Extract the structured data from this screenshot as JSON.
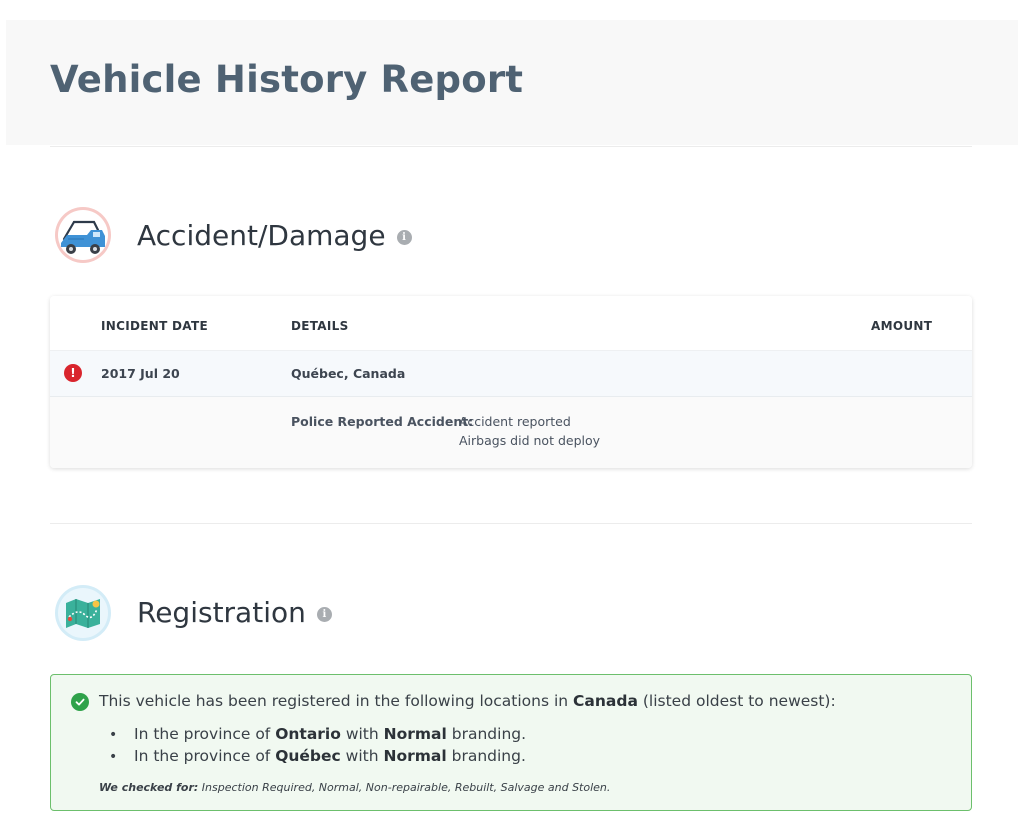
{
  "header": {
    "title": "Vehicle History Report"
  },
  "accident": {
    "title": "Accident/Damage",
    "info_icon": "info-icon",
    "section_icon": "tow-truck-icon",
    "columns": {
      "date": "INCIDENT DATE",
      "details": "DETAILS",
      "amount": "AMOUNT"
    },
    "incident": {
      "date": "2017 Jul 20",
      "location": "Québec, Canada",
      "detail_label": "Police Reported Accident:",
      "detail_lines": [
        "Accident reported",
        "Airbags did not deploy"
      ]
    }
  },
  "registration": {
    "title": "Registration",
    "info_icon": "info-icon",
    "section_icon": "map-icon",
    "summary_pre": "This vehicle has been registered in the following locations in ",
    "summary_country": "Canada",
    "summary_post": " (listed oldest to newest):",
    "locations": [
      {
        "pre": "In the province of ",
        "province": "Ontario",
        "mid": " with ",
        "branding": "Normal",
        "post": " branding."
      },
      {
        "pre": "In the province of ",
        "province": "Québec",
        "mid": " with ",
        "branding": "Normal",
        "post": " branding."
      }
    ],
    "checked_label": "We checked for:",
    "checked_items": " Inspection Required, Normal, Non-repairable, Rebuilt, Salvage and Stolen."
  },
  "colors": {
    "title": "#4f6273",
    "alert": "#d9252d",
    "success": "#2fa24a",
    "success_bg": "#f1f9f1"
  }
}
